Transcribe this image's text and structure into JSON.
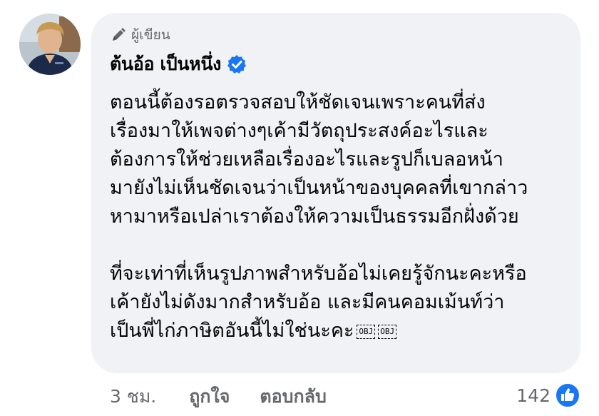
{
  "comment": {
    "author_badge_label": "ผู้เขียน",
    "author_name": "ต้นอ้อ เป็นหนึ่ง",
    "body_lines": [
      "ตอนนี้ต้องรอตรวจสอบให้ชัดเจนเพราะคนที่ส่ง",
      "เรื่องมาให้เพจต่างๆเค้ามีวัตถุประสงค์อะไรและ",
      "ต้องการให้ช่วยเหลือเรื่องอะไรและรูปก็เบลอหน้า",
      "มายังไม่เห็นชัดเจนว่าเป็นหน้าของบุคคลที่เขากล่าว",
      "หามาหรือเปล่าเราต้องให้ความเป็นธรรมอีกฝั่งด้วย"
    ],
    "body_lines_2": [
      "ที่จะเท่าที่เห็นรูปภาพสำหรับอ้อไม่เคยรู้จักนะคะหรือ",
      "เค้ายังไม่ดังมากสำหรับอ้อ และมีคนคอมเม้นท์ว่า",
      "เป็นพี่ไก่ภาษิตอันนี้ไม่ใช่นะคะ"
    ],
    "object_placeholders": [
      "OBJ",
      "OBJ"
    ],
    "time": "3 ชม.",
    "like_label": "ถูกใจ",
    "reply_label": "ตอบกลับ",
    "reaction_count": "142"
  },
  "icons": {
    "author_badge": "pen-icon",
    "verified": "verified-badge-icon",
    "reaction": "like-reaction-icon"
  },
  "colors": {
    "bubble_bg": "#f0f2f5",
    "secondary_text": "#65676b",
    "primary_text": "#050505",
    "brand_blue": "#1877f2"
  }
}
